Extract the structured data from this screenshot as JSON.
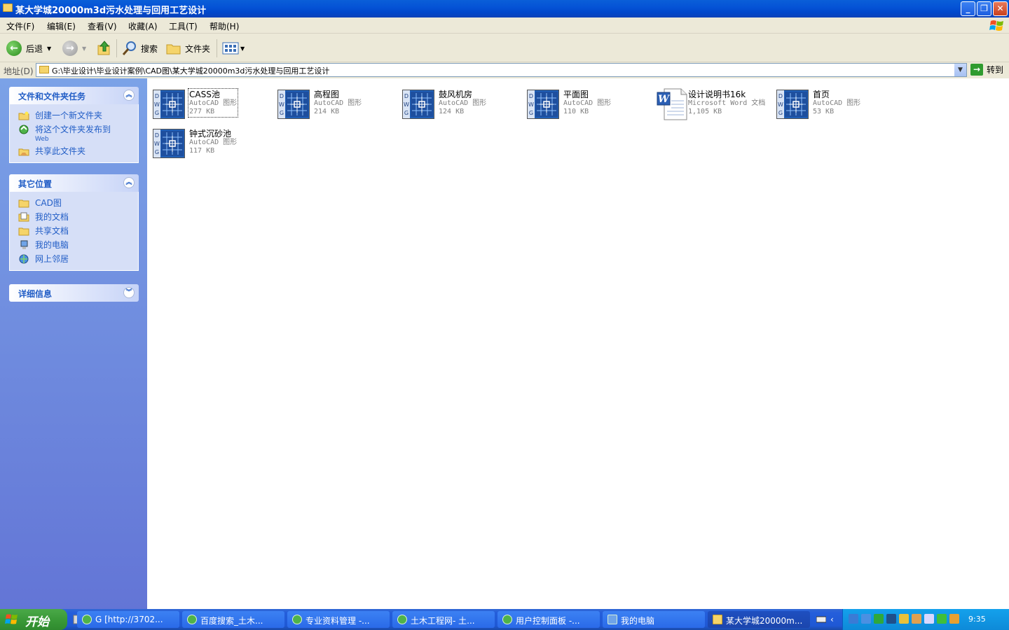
{
  "window": {
    "title": "某大学城20000m3d污水处理与回用工艺设计",
    "controls": [
      "minimize",
      "restore",
      "close"
    ]
  },
  "menu": [
    "文件(F)",
    "编辑(E)",
    "查看(V)",
    "收藏(A)",
    "工具(T)",
    "帮助(H)"
  ],
  "toolbar": {
    "back_label": "后退",
    "search_label": "搜索",
    "folders_label": "文件夹"
  },
  "address": {
    "label": "地址(D)",
    "value": "G:\\毕业设计\\毕业设计案例\\CAD图\\某大学城20000m3d污水处理与回用工艺设计",
    "go_label": "转到"
  },
  "sidebar": {
    "tasks": {
      "title": "文件和文件夹任务",
      "items": [
        {
          "label": "创建一个新文件夹",
          "icon": "new-folder-icon"
        },
        {
          "label": "将这个文件夹发布到",
          "sub": "Web",
          "icon": "publish-web-icon"
        },
        {
          "label": "共享此文件夹",
          "icon": "share-folder-icon"
        }
      ]
    },
    "places": {
      "title": "其它位置",
      "items": [
        {
          "label": "CAD图",
          "icon": "folder-icon"
        },
        {
          "label": "我的文档",
          "icon": "my-documents-icon"
        },
        {
          "label": "共享文档",
          "icon": "shared-documents-icon"
        },
        {
          "label": "我的电脑",
          "icon": "my-computer-icon"
        },
        {
          "label": "网上邻居",
          "icon": "network-places-icon"
        }
      ]
    },
    "details": {
      "title": "详细信息"
    }
  },
  "files": [
    {
      "name": "CASS池",
      "type": "AutoCAD 图形",
      "size": "277 KB",
      "icon": "dwg-icon",
      "selected": true
    },
    {
      "name": "高程图",
      "type": "AutoCAD 图形",
      "size": "214 KB",
      "icon": "dwg-icon"
    },
    {
      "name": "鼓风机房",
      "type": "AutoCAD 图形",
      "size": "124 KB",
      "icon": "dwg-icon"
    },
    {
      "name": "平面图",
      "type": "AutoCAD 图形",
      "size": "110 KB",
      "icon": "dwg-icon"
    },
    {
      "name": "设计说明书16k",
      "type": "Microsoft Word 文档",
      "size": "1,105 KB",
      "icon": "word-doc-icon"
    },
    {
      "name": "首页",
      "type": "AutoCAD 图形",
      "size": "53 KB",
      "icon": "dwg-icon"
    },
    {
      "name": "钟式沉砂池",
      "type": "AutoCAD 图形",
      "size": "117 KB",
      "icon": "dwg-icon"
    }
  ],
  "taskbar": {
    "start_label": "开始",
    "tasks": [
      "G [http://3702...",
      "百度搜索_土木...",
      "专业资料管理 -...",
      "土木工程网- 土...",
      "用户控制面板 -...",
      "我的电脑",
      "某大学城20000m..."
    ],
    "clock": "9:35"
  }
}
